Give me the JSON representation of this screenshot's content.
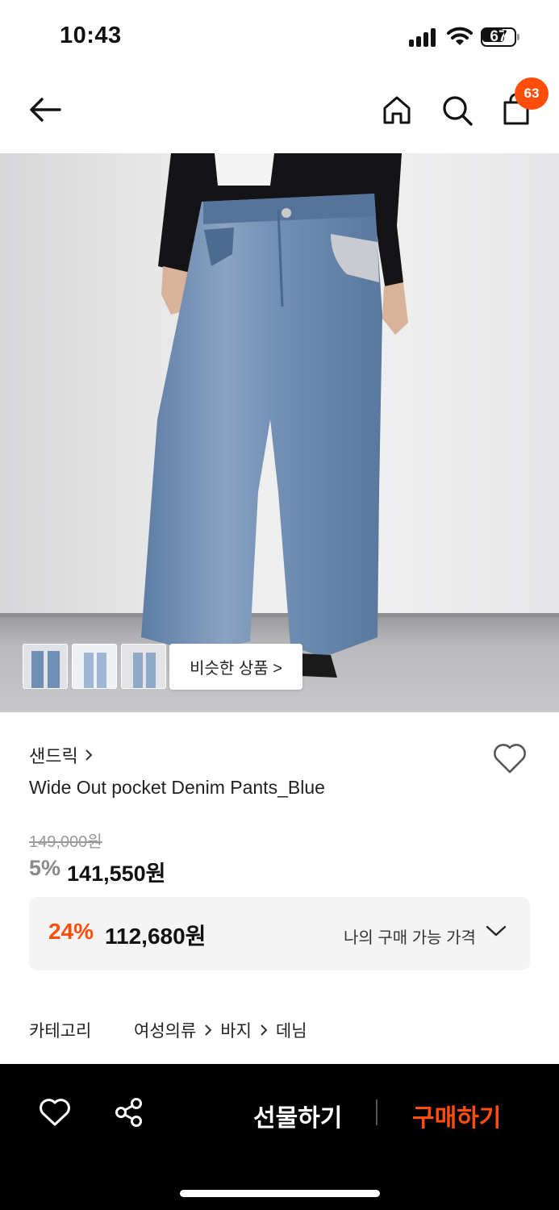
{
  "status_bar": {
    "time": "10:43",
    "battery": "67"
  },
  "header": {
    "icons": [
      "back-arrow-icon",
      "home-icon",
      "search-icon",
      "shopping-bag-icon"
    ],
    "cart_count": "63"
  },
  "gallery": {
    "thumbnail_count": 3,
    "similar_button_label": "비슷한 상품 >"
  },
  "product": {
    "brand": "샌드릭",
    "name": "Wide Out pocket Denim Pants_Blue",
    "original_price": "149,000원",
    "discount_rate": "5%",
    "sale_price": "141,550원",
    "my_price": {
      "rate": "24%",
      "amount": "112,680원",
      "label": "나의 구매 가능 가격"
    }
  },
  "category": {
    "label": "카테고리",
    "path": [
      "여성의류",
      "바지",
      "데님"
    ]
  },
  "bottom_bar": {
    "gift_label": "선물하기",
    "buy_label": "구매하기"
  },
  "colors": {
    "accent": "#ff4d0a",
    "bar": "#000000"
  }
}
